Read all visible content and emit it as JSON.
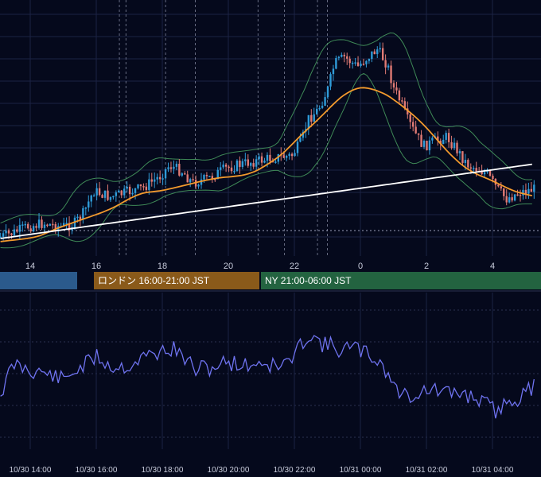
{
  "colors": {
    "background": "#05091c",
    "grid": "#1b2244",
    "candle_up": "#2f9bd8",
    "candle_down": "#e07a74",
    "bollinger": "#3f8a57",
    "ma_mid": "#f39a2d",
    "ma_long": "#ffffff",
    "oscillator": "#6f73f0",
    "session_tokyo": "#2b5a8c",
    "session_london": "#8a5a1a",
    "session_ny": "#236340"
  },
  "sessions": [
    {
      "id": "tokyo",
      "label": ""
    },
    {
      "id": "london",
      "label": "ロンドン 16:00-21:00 JST"
    },
    {
      "id": "ny",
      "label": "NY 21:00-06:00 JST"
    }
  ],
  "chart_data": [
    {
      "type": "candlestick",
      "panel": "price",
      "x_tick_labels": [
        "14",
        "16",
        "18",
        "20",
        "22",
        "0",
        "2",
        "4"
      ],
      "x_ticks_hours": [
        14,
        16,
        18,
        20,
        22,
        24,
        26,
        28
      ],
      "xlim_hours": [
        13.1,
        29.3
      ],
      "ylim": [
        0,
        330
      ],
      "grid": true,
      "indicators": [
        "bollinger_bands",
        "moving_average_mid",
        "moving_average_long"
      ],
      "event_lines_hours": [
        16.7,
        16.9,
        18.1,
        19.0,
        20.9,
        21.7,
        22.7,
        23.0
      ],
      "ohlc_trend": [
        [
          13.1,
          299
        ],
        [
          13.5,
          294
        ],
        [
          14.0,
          285
        ],
        [
          14.5,
          281
        ],
        [
          15.0,
          285
        ],
        [
          15.4,
          282
        ],
        [
          15.7,
          268
        ],
        [
          16.0,
          240
        ],
        [
          16.5,
          248
        ],
        [
          17.0,
          242
        ],
        [
          17.5,
          236
        ],
        [
          18.0,
          222
        ],
        [
          18.3,
          208
        ],
        [
          18.7,
          216
        ],
        [
          19.0,
          230
        ],
        [
          19.5,
          224
        ],
        [
          20.0,
          212
        ],
        [
          20.5,
          206
        ],
        [
          21.0,
          202
        ],
        [
          21.5,
          198
        ],
        [
          22.0,
          196
        ],
        [
          22.3,
          178
        ],
        [
          22.5,
          150
        ],
        [
          22.8,
          138
        ],
        [
          23.1,
          112
        ],
        [
          23.3,
          80
        ],
        [
          23.6,
          72
        ],
        [
          24.0,
          84
        ],
        [
          24.3,
          72
        ],
        [
          24.6,
          62
        ],
        [
          24.9,
          82
        ],
        [
          25.1,
          112
        ],
        [
          25.3,
          128
        ],
        [
          25.5,
          150
        ],
        [
          25.8,
          172
        ],
        [
          26.0,
          184
        ],
        [
          26.3,
          178
        ],
        [
          26.7,
          172
        ],
        [
          27.0,
          188
        ],
        [
          27.3,
          206
        ],
        [
          27.6,
          212
        ],
        [
          27.9,
          218
        ],
        [
          28.2,
          236
        ],
        [
          28.5,
          250
        ],
        [
          28.9,
          242
        ],
        [
          29.3,
          238
        ]
      ]
    },
    {
      "type": "line",
      "panel": "oscillator",
      "x_tick_labels": [
        "10/30 14:00",
        "10/30 16:00",
        "10/30 18:00",
        "10/30 20:00",
        "10/30 22:00",
        "10/31 00:00",
        "10/31 02:00",
        "10/31 04:00"
      ],
      "x_ticks_hours": [
        14,
        16,
        18,
        20,
        22,
        24,
        26,
        28
      ],
      "grid": true,
      "series_trend": [
        [
          13.1,
          495
        ],
        [
          13.5,
          458
        ],
        [
          14.0,
          465
        ],
        [
          14.5,
          470
        ],
        [
          15.0,
          478
        ],
        [
          15.4,
          465
        ],
        [
          15.7,
          458
        ],
        [
          16.0,
          448
        ],
        [
          16.5,
          462
        ],
        [
          17.0,
          460
        ],
        [
          17.5,
          448
        ],
        [
          18.0,
          442
        ],
        [
          18.3,
          438
        ],
        [
          18.7,
          452
        ],
        [
          19.0,
          465
        ],
        [
          19.5,
          462
        ],
        [
          20.0,
          455
        ],
        [
          20.5,
          460
        ],
        [
          21.0,
          455
        ],
        [
          21.5,
          462
        ],
        [
          22.0,
          450
        ],
        [
          22.3,
          425
        ],
        [
          22.5,
          420
        ],
        [
          22.8,
          432
        ],
        [
          23.1,
          435
        ],
        [
          23.3,
          440
        ],
        [
          23.6,
          438
        ],
        [
          24.0,
          440
        ],
        [
          24.3,
          448
        ],
        [
          24.6,
          455
        ],
        [
          24.9,
          475
        ],
        [
          25.1,
          492
        ],
        [
          25.3,
          495
        ],
        [
          25.5,
          498
        ],
        [
          25.8,
          494
        ],
        [
          26.0,
          490
        ],
        [
          26.3,
          492
        ],
        [
          26.7,
          496
        ],
        [
          27.0,
          494
        ],
        [
          27.3,
          498
        ],
        [
          27.6,
          502
        ],
        [
          27.9,
          512
        ],
        [
          28.2,
          518
        ],
        [
          28.5,
          502
        ],
        [
          28.9,
          500
        ],
        [
          29.3,
          482
        ]
      ]
    }
  ]
}
